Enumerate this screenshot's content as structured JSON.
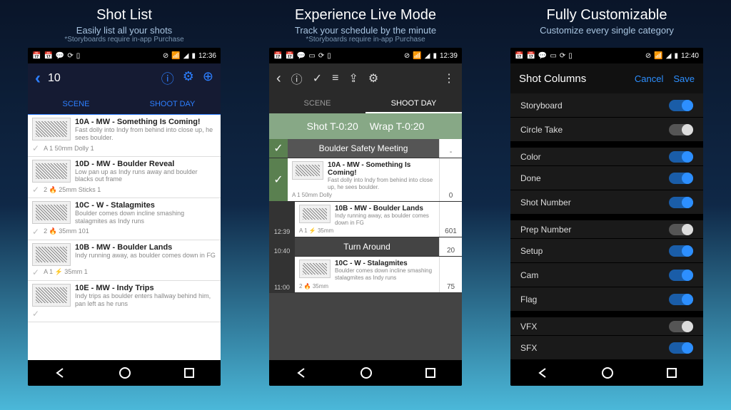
{
  "col1": {
    "title": "Shot List",
    "sub": "Easily list all your shots",
    "note": "*Storyboards require in-app Purchase",
    "time": "12:36",
    "hdr_title": "10",
    "tabs": [
      "SCENE",
      "SHOOT DAY"
    ],
    "shots": [
      {
        "title": "10A - MW - Something Is Coming!",
        "desc": "Fast dolly into Indy from behind into close up, he sees boulder.",
        "meta": "A  1   50mm   Dolly   1"
      },
      {
        "title": "10D - MW - Boulder Reveal",
        "desc": "Low pan up as Indy runs away and boulder blacks out frame",
        "meta": "2   🔥  25mm   Sticks   1"
      },
      {
        "title": "10C - W - Stalagmites",
        "desc": "Boulder comes down incline smashing stalagmites as Indy runs",
        "meta": "2   🔥  35mm   101"
      },
      {
        "title": "10B - MW - Boulder Lands",
        "desc": "Indy running away, as boulder comes down in FG",
        "meta": "A  1   ⚡  35mm   1"
      },
      {
        "title": "10E - MW - Indy Trips",
        "desc": "Indy trips as boulder enters hallway behind him, pan left as he runs",
        "meta": ""
      }
    ]
  },
  "col2": {
    "title": "Experience Live Mode",
    "sub": "Track your schedule by the minute",
    "note": "*Storyboards require in-app Purchase",
    "time": "12:39",
    "tabs": [
      "SCENE",
      "SHOOT DAY"
    ],
    "timer": {
      "shot": "Shot T-0:20",
      "wrap": "Wrap T-0:20"
    },
    "banner1": "Boulder Safety Meeting",
    "banner1_count": "-",
    "rows": [
      {
        "time": "",
        "check": true,
        "title": "10A - MW - Something Is Coming!",
        "desc": "Fast dolly into Indy from behind into close up, he sees boulder.",
        "meta": "A  1   50mm   Dolly",
        "count": "0"
      },
      {
        "time": "12:39",
        "check": false,
        "title": "10B - MW - Boulder Lands",
        "desc": "Indy running away, as boulder comes down in FG",
        "meta": "A  1   ⚡  35mm",
        "count": "601"
      }
    ],
    "banner2": "Turn Around",
    "banner2_time": "10:40",
    "banner2_count": "20",
    "row3": {
      "time": "11:00",
      "title": "10C - W - Stalagmites",
      "desc": "Boulder comes down incline smashing stalagmites as Indy runs",
      "meta": "2   🔥  35mm",
      "count": "75"
    }
  },
  "col3": {
    "title": "Fully Customizable",
    "sub": "Customize every single category",
    "time": "12:40",
    "hdr_title": "Shot Columns",
    "cancel": "Cancel",
    "save": "Save",
    "settings": [
      {
        "label": "Storyboard",
        "on": true,
        "gap": false
      },
      {
        "label": "Circle Take",
        "on": false,
        "gap": false
      },
      {
        "label": "Color",
        "on": true,
        "gap": true
      },
      {
        "label": "Done",
        "on": true,
        "gap": false
      },
      {
        "label": "Shot Number",
        "on": true,
        "gap": false
      },
      {
        "label": "Prep Number",
        "on": false,
        "gap": true
      },
      {
        "label": "Setup",
        "on": true,
        "gap": false
      },
      {
        "label": "Cam",
        "on": true,
        "gap": false
      },
      {
        "label": "Flag",
        "on": true,
        "gap": false
      },
      {
        "label": "VFX",
        "on": false,
        "gap": true
      },
      {
        "label": "SFX",
        "on": true,
        "gap": false
      }
    ]
  }
}
